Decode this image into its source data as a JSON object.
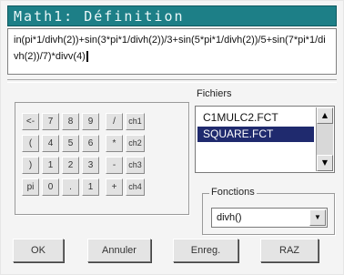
{
  "window": {
    "title": "Math1: Définition"
  },
  "expression": {
    "value": "in(pi*1/divh(2))+sin(3*pi*1/divh(2))/3+sin(5*pi*1/divh(2))/5+sin(7*pi*1/divh(2))/7)*divv(4)"
  },
  "keypad": {
    "rows": [
      [
        "<-",
        "7",
        "8",
        "9",
        "/",
        "ch1"
      ],
      [
        "(",
        "4",
        "5",
        "6",
        "*",
        "ch2"
      ],
      [
        ")",
        "1",
        "2",
        "3",
        "-",
        "ch3"
      ],
      [
        "pi",
        "0",
        ".",
        "1",
        "+",
        "ch4"
      ]
    ]
  },
  "files": {
    "label": "Fichiers",
    "items": [
      "C1MULC2.FCT",
      "SQUARE.FCT",
      ""
    ],
    "selected_index": 1,
    "scroll_up_icon": "triangle-up-icon",
    "scroll_down_icon": "triangle-down-icon"
  },
  "functions": {
    "label": "Fonctions",
    "selected": "divh()",
    "dropdown_icon": "triangle-down-icon"
  },
  "buttons": {
    "ok": "OK",
    "cancel": "Annuler",
    "save": "Enreg.",
    "reset": "RAZ"
  },
  "colors": {
    "titlebar": "#1d7f87",
    "selection": "#1f2a6e"
  }
}
